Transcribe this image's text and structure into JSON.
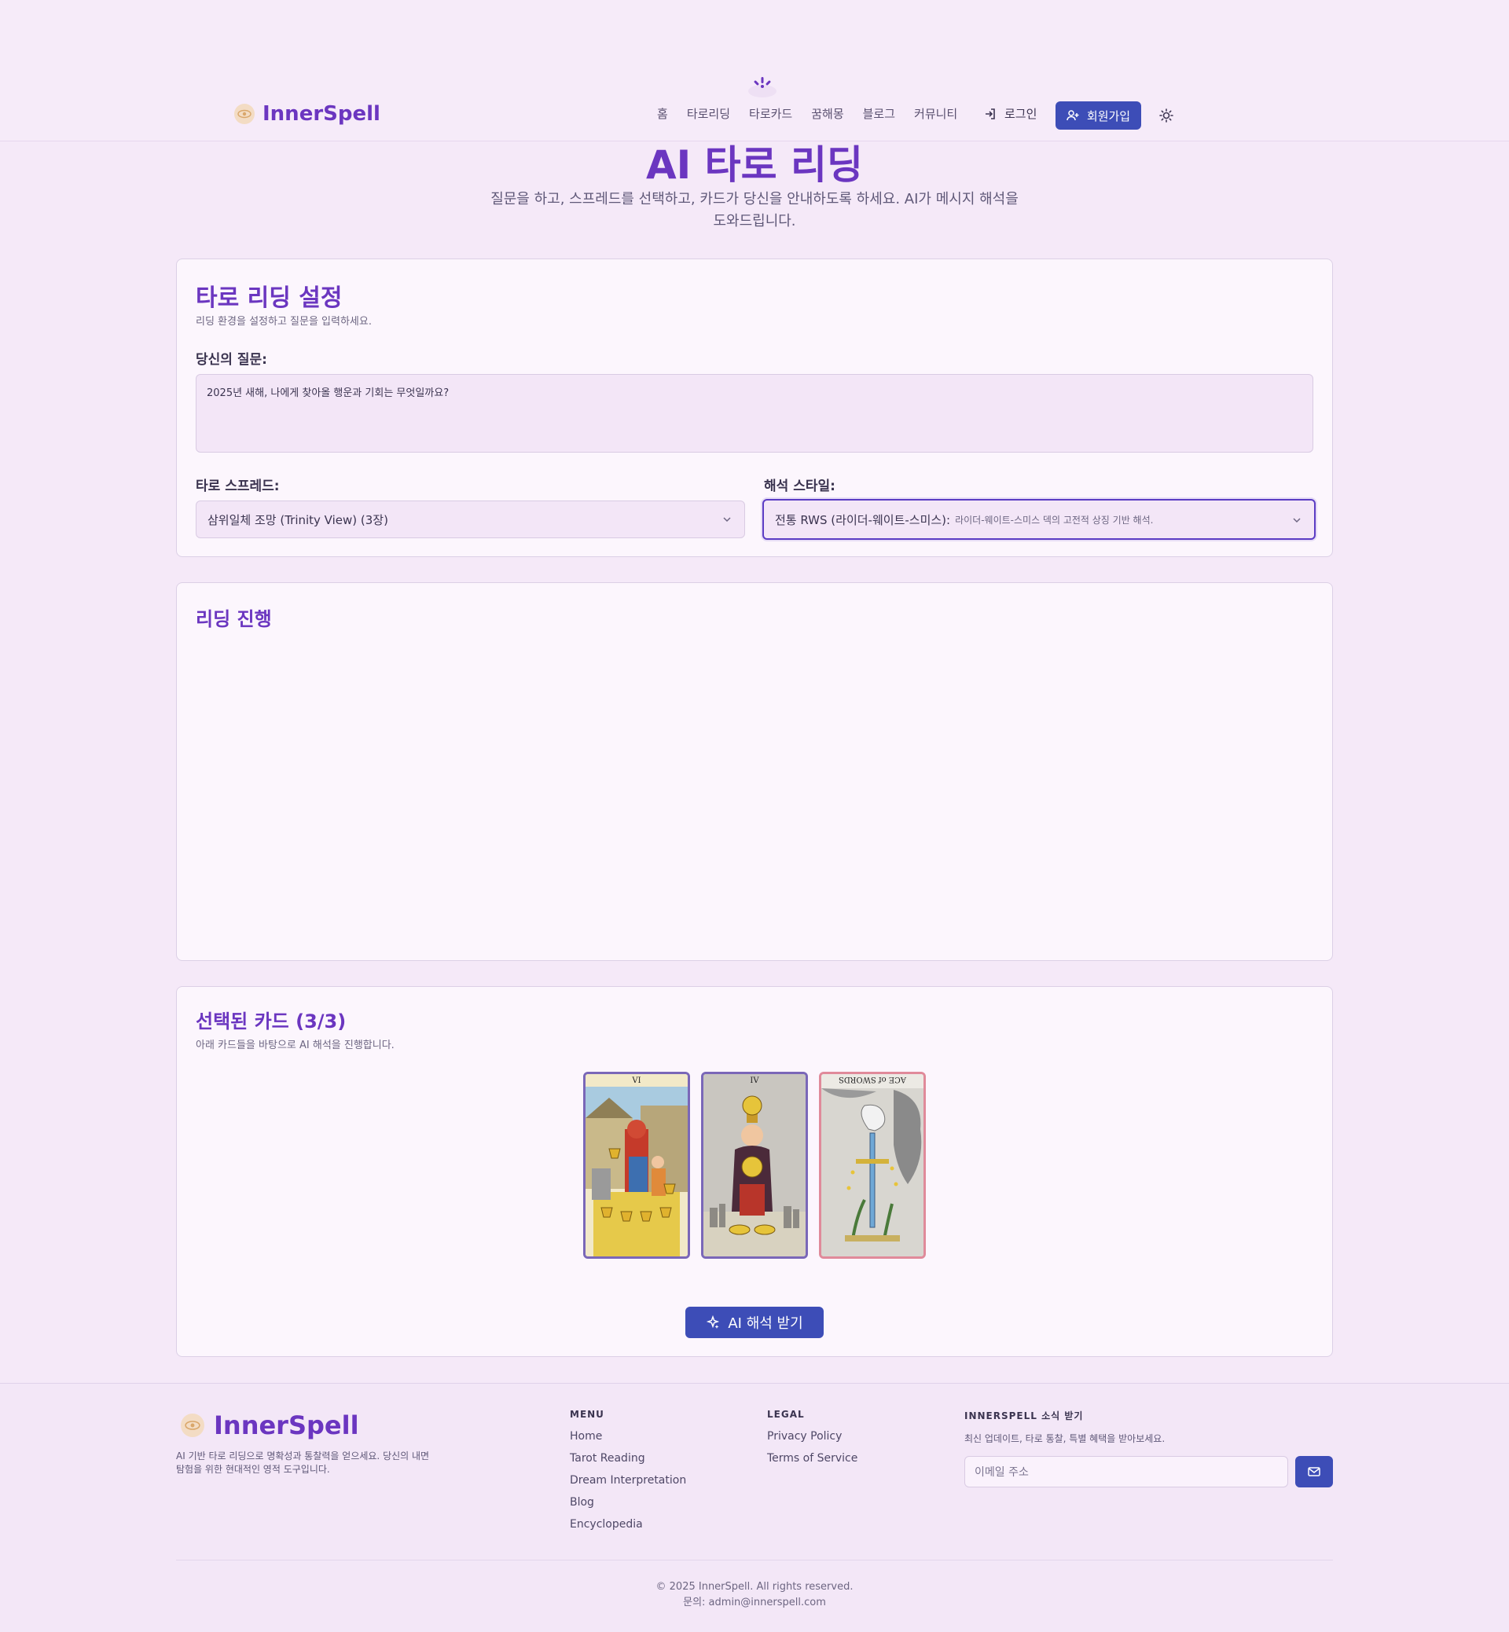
{
  "brand": {
    "name": "InnerSpell"
  },
  "nav": {
    "items": [
      "홈",
      "타로리딩",
      "타로카드",
      "꿈해몽",
      "블로그",
      "커뮤니티"
    ],
    "login_label": "로그인",
    "signup_label": "회원가입"
  },
  "hero": {
    "title": "AI 타로 리딩",
    "subtitle": "질문을 하고, 스프레드를 선택하고, 카드가 당신을 안내하도록 하세요. AI가 메시지 해석을 도와드립니다."
  },
  "settings": {
    "title": "타로 리딩 설정",
    "description": "리딩 환경을 설정하고 질문을 입력하세요.",
    "question_label": "당신의 질문:",
    "question_value": "2025년 새해, 나에게 찾아올 행운과 기회는 무엇일까요?",
    "spread_label": "타로 스프레드:",
    "spread_value": "삼위일체 조망 (Trinity View) (3장)",
    "style_label": "해석 스타일:",
    "style_value": "전통 RWS (라이더-웨이트-스미스):",
    "style_desc": "라이더-웨이트-스미스 덱의 고전적 상징 기반 해석."
  },
  "progress": {
    "title": "리딩 진행"
  },
  "selected": {
    "title": "선택된 카드 (3/3)",
    "description": "아래 카드들을 바탕으로 AI 해석을 진행합니다.",
    "cards": [
      {
        "numeral": "VI",
        "name": "Six of Cups",
        "reversed": false
      },
      {
        "numeral": "IV",
        "name": "Four of Pentacles",
        "reversed": false
      },
      {
        "numeral": "ACE of SWORDS",
        "name": "Ace of Swords",
        "reversed": true
      }
    ],
    "ai_button": "AI 해석 받기"
  },
  "footer": {
    "tagline": "AI 기반 타로 리딩으로 명확성과 통찰력을 얻으세요. 당신의 내면 탐험을 위한 현대적인 영적 도구입니다.",
    "menu_heading": "MENU",
    "menu": [
      "Home",
      "Tarot Reading",
      "Dream Interpretation",
      "Blog",
      "Encyclopedia"
    ],
    "legal_heading": "LEGAL",
    "legal": [
      "Privacy Policy",
      "Terms of Service"
    ],
    "news_heading": "INNERSPELL 소식 받기",
    "news_desc": "최신 업데이트, 타로 통찰, 특별 혜택을 받아보세요.",
    "email_placeholder": "이메일 주소",
    "copyright": "© 2025 InnerSpell. All rights reserved.",
    "contact": "문의: admin@innerspell.com"
  },
  "colors": {
    "accent": "#6b36c0",
    "button": "#3d4db7",
    "background": "#f5e9f8"
  }
}
